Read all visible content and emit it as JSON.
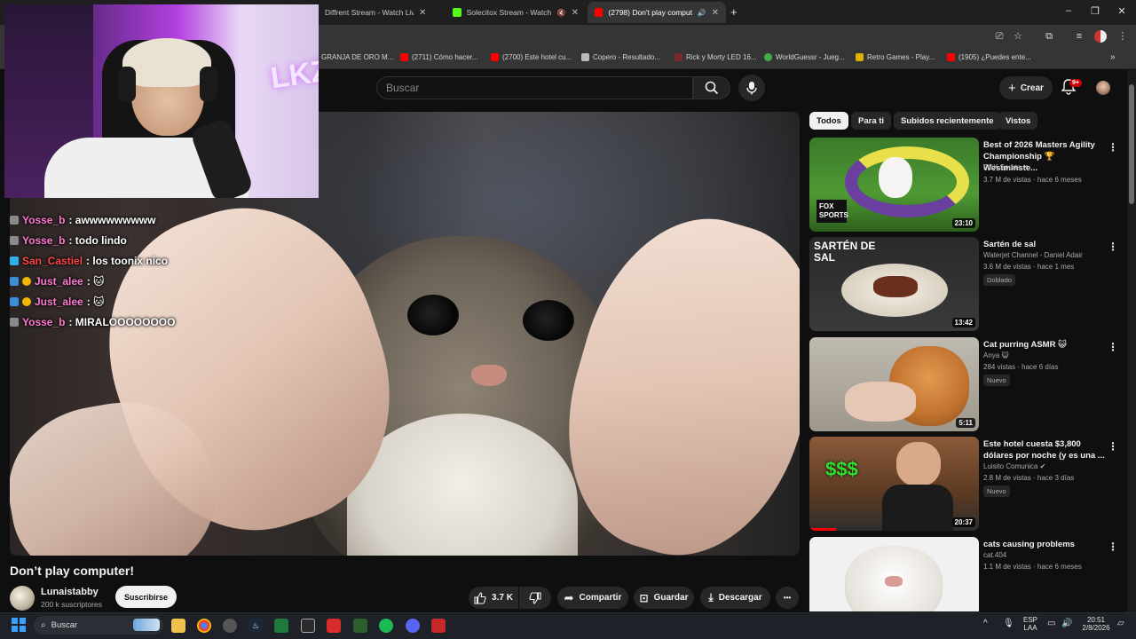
{
  "browser": {
    "tabs": [
      {
        "title": "Diffrent Stream - Watch Liv",
        "favicon_color": "#4a8fd9"
      },
      {
        "title": "Solecitox Stream - Watch Li",
        "favicon_color": "#53fc18"
      },
      {
        "title": "(2798) Don't play compute",
        "favicon_color": "#ff0000",
        "active": true
      }
    ],
    "new_tab": "+",
    "bookmarks": [
      {
        "label": "GRANJA DE ORO M...",
        "color": "#888888"
      },
      {
        "label": "(2711) Cómo hacer...",
        "color": "#ff0000"
      },
      {
        "label": "(2700) Este hotel cu...",
        "color": "#ff0000"
      },
      {
        "label": "Copero - Resultado...",
        "color": "#bbbbbb"
      },
      {
        "label": "Rick y Morty LED 16...",
        "color": "#7a2a2a"
      },
      {
        "label": "WorldGuessr - Jueg...",
        "color": "#3fae4a"
      },
      {
        "label": "Retro Games - Play...",
        "color": "#e0b000"
      },
      {
        "label": "(1905) ¿Puedes ente...",
        "color": "#ff0000"
      }
    ]
  },
  "header": {
    "search_placeholder": "Buscar",
    "create_label": "Crear",
    "notif_count": "9+"
  },
  "chat": [
    {
      "user": "Yosse_b",
      "message": ": awwwwwwwww",
      "color": "#ff7ad1"
    },
    {
      "user": "Yosse_b",
      "message": ": todo lindo",
      "color": "#ff7ad1"
    },
    {
      "user": "San_Castiel",
      "message": ": los toonix nico",
      "color": "#ff4444"
    },
    {
      "user": "Just_alee",
      "message": ": 🐱",
      "color": "#ff7ad1"
    },
    {
      "user": "Just_alee",
      "message": ": 🐱",
      "color": "#ff7ad1"
    },
    {
      "user": "Yosse_b",
      "message": ": MIRALOOOOOOOO",
      "color": "#ff7ad1"
    }
  ],
  "webcam": {
    "sign": "LKZ"
  },
  "video": {
    "title": "Don’t play computer!",
    "channel": "Lunaistabby",
    "subscribers": "200 k suscriptores",
    "subscribe_label": "Suscribirse",
    "likes": "3.7 K",
    "share_label": "Compartir",
    "save_label": "Guardar",
    "download_label": "Descargar",
    "more": "•••"
  },
  "sidebar": {
    "chips": [
      "Todos",
      "Para ti",
      "Subidos recientemente",
      "Vistos"
    ],
    "recommendations": [
      {
        "title": "Best of 2026 Masters Agility Championship 🏆 Westminste...",
        "channel": "FOX Sports ✔",
        "meta": "3.7 M de vistas · hace 6 meses",
        "tag": "",
        "duration": "23:10",
        "thumb_label": "FOX SPORTS"
      },
      {
        "title": "Sartén de sal",
        "channel": "Waterjet Channel - Daniel Adair",
        "meta": "3.6 M de vistas · hace 1 mes",
        "tag": "Doblado",
        "duration": "13:42",
        "thumb_label": "SARTÉN DE SAL"
      },
      {
        "title": "Cat purring ASMR 😺",
        "channel": "Anya 😺",
        "meta": "284 vistas · hace 6 días",
        "tag": "Nuevo",
        "duration": "5:11",
        "thumb_label": ""
      },
      {
        "title": "Este hotel cuesta $3,800 dólares por noche (y es una ...",
        "channel": "Luisito Comunica ✔",
        "meta": "2.8 M de vistas · hace 3 días",
        "tag": "Nuevo",
        "duration": "20:37",
        "thumb_label": "$$$"
      },
      {
        "title": "cats causing problems",
        "channel": "cat.404",
        "meta": "1.1 M de vistas · hace 6 meses",
        "tag": "",
        "duration": "",
        "thumb_label": ""
      }
    ]
  },
  "taskbar": {
    "search_label": "Buscar",
    "lang": "ESP",
    "lang2": "LAA",
    "time": "20:51",
    "date": "2/8/2026"
  }
}
